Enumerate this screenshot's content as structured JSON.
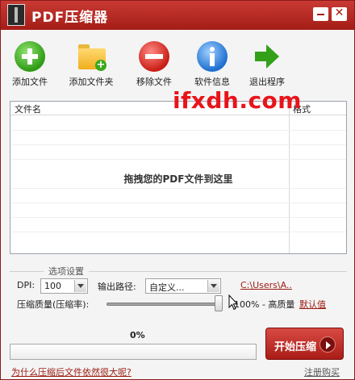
{
  "window": {
    "title": "PDF压缩器"
  },
  "toolbar": {
    "add_file": "添加文件",
    "add_folder": "添加文件夹",
    "remove_file": "移除文件",
    "software_info": "软件信息",
    "exit": "退出程序"
  },
  "watermark": "ifxdh.com",
  "file_list": {
    "columns": [
      "文件名",
      "格式"
    ],
    "empty_hint": "拖拽您的PDF文件到这里"
  },
  "options": {
    "group_title": "选项设置",
    "dpi_label": "DPI:",
    "dpi_value": "100",
    "output_path_label": "输出路径:",
    "output_path_value": "自定义...",
    "output_path_link": "C:\\Users\\A..",
    "quality_label": "压缩质量(压缩率):",
    "quality_value_text": "100% - 高质量",
    "quality_level": 1.0,
    "default_link": "默认值"
  },
  "progress": {
    "percent_text": "0%",
    "fraction": 0
  },
  "actions": {
    "start_label": "开始压缩",
    "help_link": "为什么压缩后文件依然很大呢?",
    "register_link": "注册购买"
  },
  "colors": {
    "title_bar": "#b7261f",
    "link_red": "#9b1b12",
    "watermark_red": "#e8141a"
  }
}
